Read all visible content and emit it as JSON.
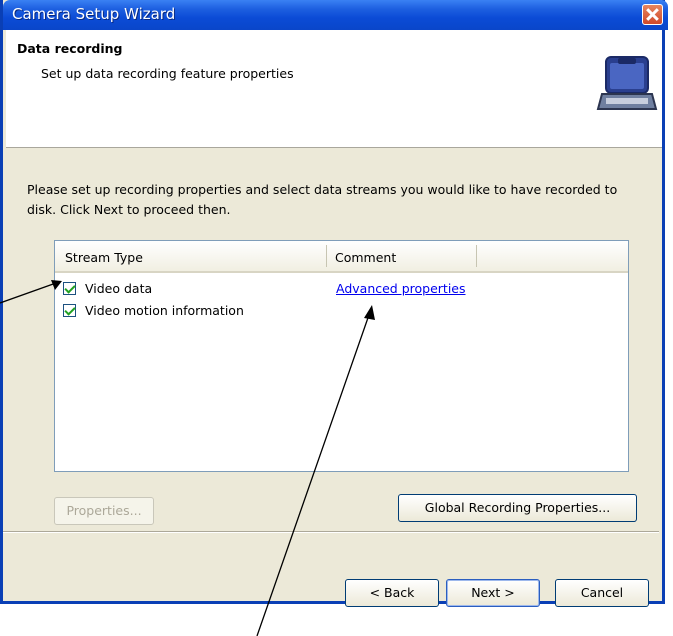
{
  "window": {
    "title": "Camera Setup Wizard"
  },
  "header": {
    "title": "Data recording",
    "subtitle": "Set up data recording feature properties"
  },
  "instructions": {
    "line1": "Please set up recording properties and select data streams you would like to have recorded to",
    "line2": "disk. Click Next to proceed then."
  },
  "streams": {
    "columns": [
      "Stream Type",
      "Comment"
    ],
    "rows": [
      {
        "label": "Video data",
        "checked": true,
        "comment": "Advanced properties"
      },
      {
        "label": "Video motion information",
        "checked": true,
        "comment": ""
      }
    ]
  },
  "buttons": {
    "properties": "Properties...",
    "global": "Global Recording Properties...",
    "back": "< Back",
    "next": "Next >",
    "cancel": "Cancel"
  },
  "icons": {
    "header": "laptop-case-icon",
    "close": "close-icon"
  },
  "colors": {
    "titlebar": "#0b4bd6",
    "close": "#d0492a",
    "link": "#0000ee"
  }
}
